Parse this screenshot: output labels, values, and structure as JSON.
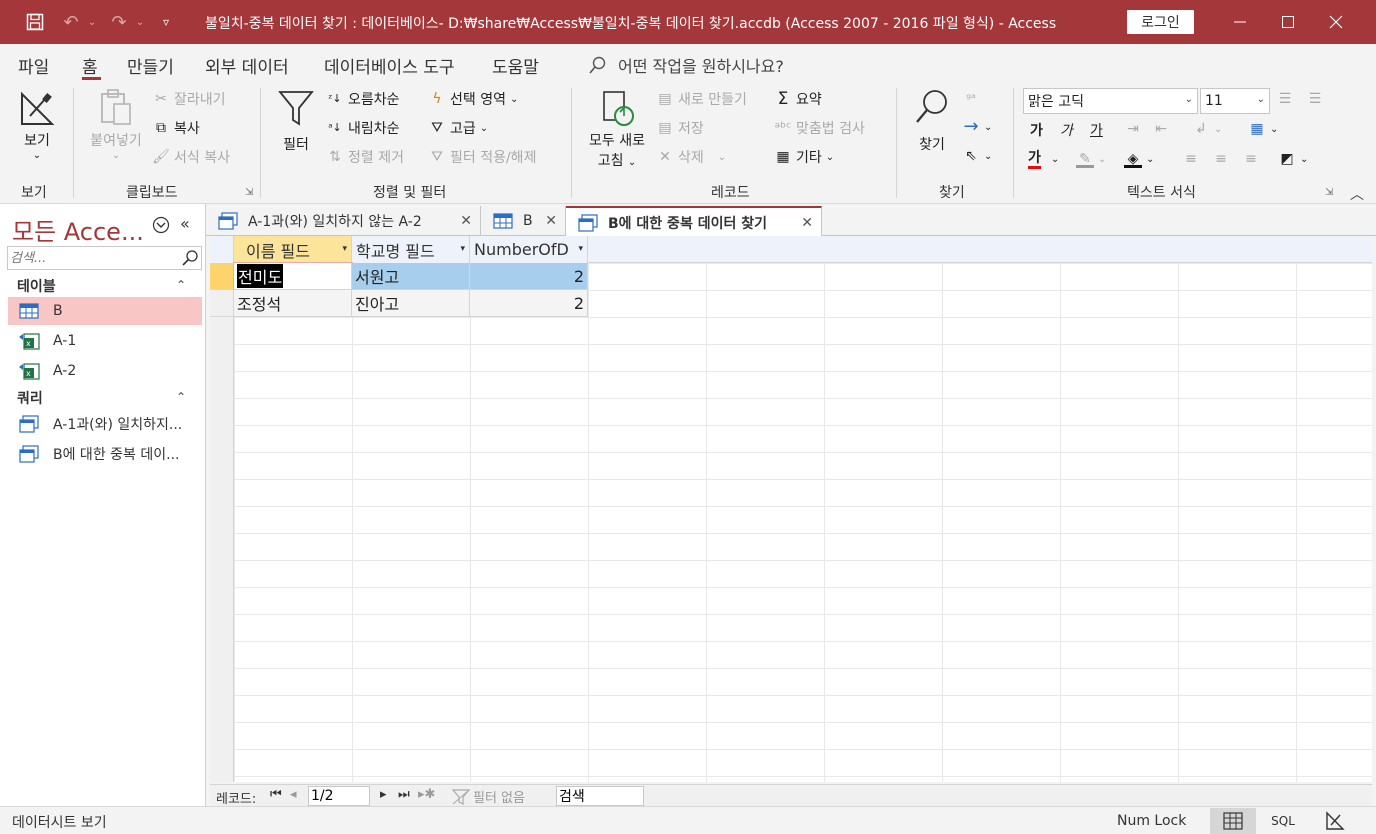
{
  "titlebar": {
    "title": "불일치-중복 데이터 찾기 : 데이터베이스- D:₩share₩Access₩불일치-중복 데이터 찾기.accdb (Access 2007 - 2016 파일 형식)  -  Access",
    "login": "로그인"
  },
  "menu": {
    "tabs": [
      "파일",
      "홈",
      "만들기",
      "외부 데이터",
      "데이터베이스 도구",
      "도움말"
    ],
    "tellme": "어떤 작업을 원하시나요?"
  },
  "ribbon": {
    "view": {
      "label": "보기",
      "group": "보기"
    },
    "clipboard": {
      "paste": "붙여넣기",
      "cut": "잘라내기",
      "copy": "복사",
      "format_painter": "서식 복사",
      "group": "클립보드"
    },
    "sortfilter": {
      "filter": "필터",
      "ascending": "오름차순",
      "descending": "내림차순",
      "remove_sort": "정렬 제거",
      "selection": "선택 영역",
      "advanced": "고급",
      "toggle_filter": "필터 적용/해제",
      "group": "정렬 및 필터"
    },
    "records": {
      "refresh_line1": "모두 새로",
      "refresh_line2": "고침",
      "new": "새로 만들기",
      "save": "저장",
      "delete": "삭제",
      "totals": "요약",
      "spelling": "맞춤법 검사",
      "more": "기타",
      "group": "레코드"
    },
    "find": {
      "label": "찾기",
      "group": "찾기"
    },
    "textformat": {
      "font": "맑은 고딕",
      "size": "11",
      "bold": "가",
      "italic": "가",
      "underline": "가",
      "fontcolor": "가",
      "group": "텍스트 서식"
    }
  },
  "nav": {
    "title": "모든 Acce...",
    "search_placeholder": "검색...",
    "tables_header": "테이블",
    "tables": [
      "B",
      "A-1",
      "A-2"
    ],
    "queries_header": "쿼리",
    "queries": [
      "A-1과(와) 일치하지...",
      "B에 대한 중복 데이..."
    ]
  },
  "doctabs": [
    "A-1과(와) 일치하지 않는 A-2",
    "B",
    "B에 대한 중복 데이터 찾기"
  ],
  "datasheet": {
    "columns": [
      "이름 필드",
      "학교명 필드",
      "NumberOfD"
    ],
    "rows": [
      [
        "전미도",
        "서원고",
        "2"
      ],
      [
        "조정석",
        "진아고",
        "2"
      ]
    ]
  },
  "recnav": {
    "label": "레코드:",
    "position": "1/2",
    "filter": "필터 없음",
    "search": "검색"
  },
  "status": {
    "left": "데이터시트 보기",
    "numlock": "Num Lock",
    "sql": "SQL"
  },
  "colors": {
    "accent": "#a4373a",
    "selected_nav": "#f9c6c6",
    "active_header": "#fce59b",
    "row_highlight": "#a8ceee"
  }
}
